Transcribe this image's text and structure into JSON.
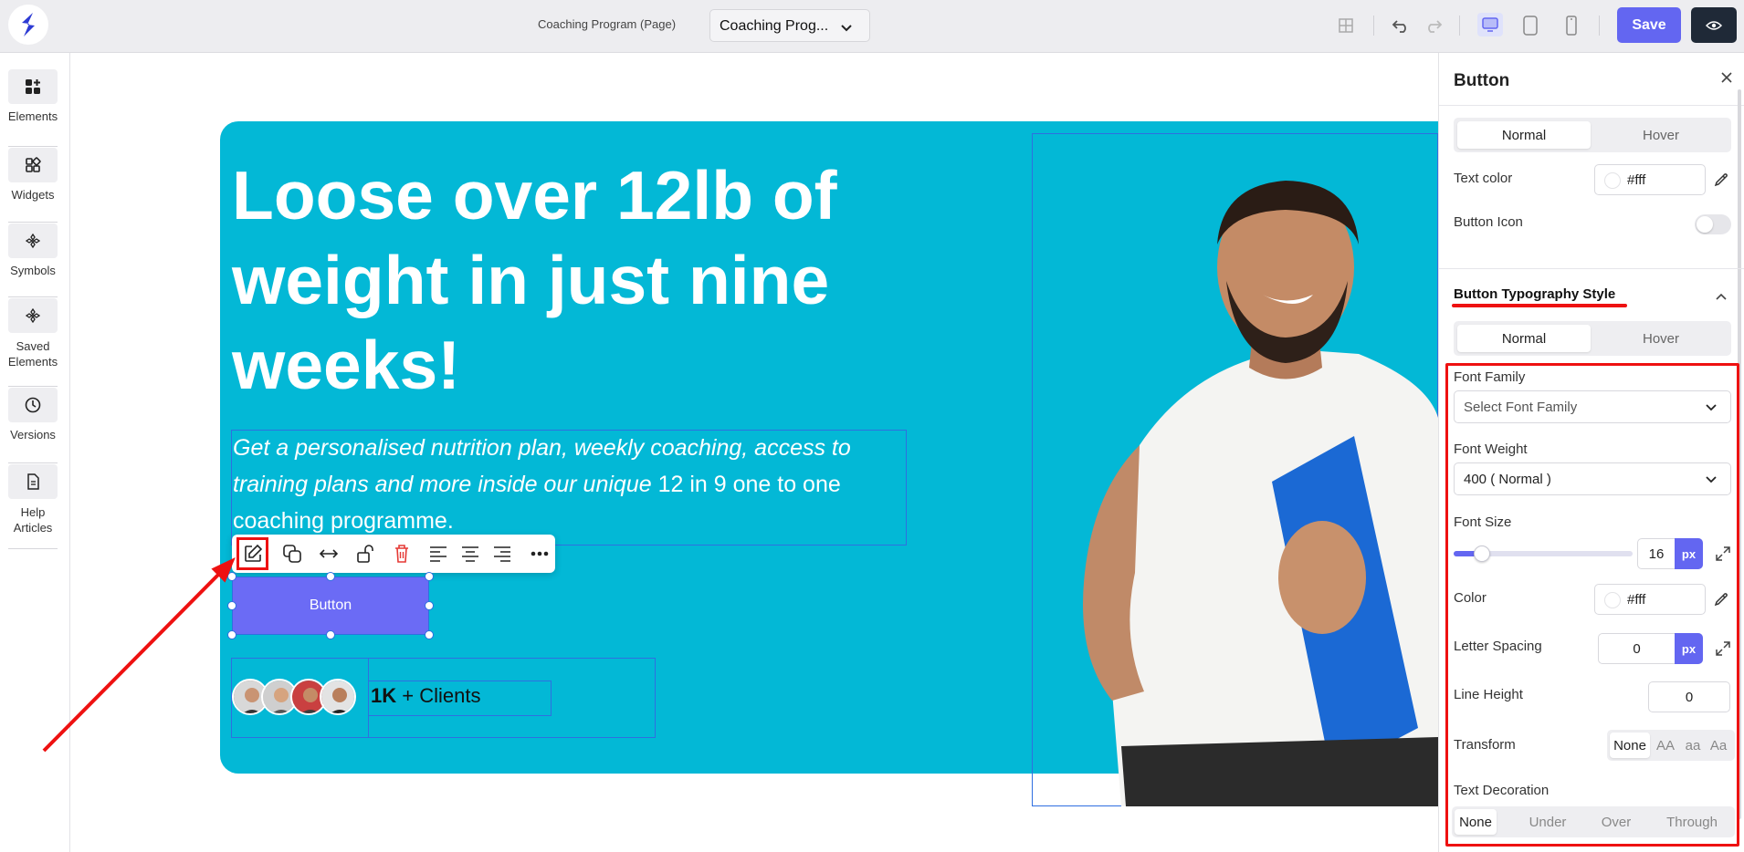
{
  "topbar": {
    "page_label": "Coaching Program (Page)",
    "page_select_value": "Coaching Prog...",
    "save_label": "Save"
  },
  "rail": {
    "items": [
      {
        "label": "Elements",
        "icon": "elements-icon"
      },
      {
        "label": "Widgets",
        "icon": "widgets-icon"
      },
      {
        "label": "Symbols",
        "icon": "symbols-icon"
      },
      {
        "label": "Saved Elements",
        "icon": "saved-elements-icon"
      },
      {
        "label": "Versions",
        "icon": "history-icon"
      },
      {
        "label": "Help Articles",
        "icon": "document-icon"
      }
    ]
  },
  "hero": {
    "title": "Loose over 12lb of weight in just nine weeks!",
    "subtitle_italic": "Get a personalised nutrition plan, weekly coaching, access to training plans and more inside our unique ",
    "subtitle_plain": "12 in 9 one to one coaching programme.",
    "button_label": "Button",
    "clients_bold": "1K",
    "clients_rest": " + Clients",
    "bg_color": "#03b8d6"
  },
  "panel": {
    "title": "Button",
    "state_tabs": [
      "Normal",
      "Hover"
    ],
    "text_color_label": "Text color",
    "text_color_value": "#fff",
    "button_icon_label": "Button Icon",
    "typography_title": "Button Typography Style",
    "typo_tabs": [
      "Normal",
      "Hover"
    ],
    "font_family_label": "Font Family",
    "font_family_placeholder": "Select Font Family",
    "font_weight_label": "Font Weight",
    "font_weight_value": "400 ( Normal )",
    "font_size_label": "Font Size",
    "font_size_value": "16",
    "font_size_unit": "px",
    "font_size_slider_fraction": 0.16,
    "color_label": "Color",
    "color_value": "#fff",
    "letter_spacing_label": "Letter Spacing",
    "letter_spacing_value": "0",
    "letter_spacing_unit": "px",
    "line_height_label": "Line Height",
    "line_height_value": "0",
    "transform_label": "Transform",
    "transform_options": [
      "None",
      "AA",
      "aa",
      "Aa"
    ],
    "text_decoration_label": "Text Decoration",
    "decoration_options": [
      "None",
      "Under",
      "Over",
      "Through"
    ]
  },
  "colors": {
    "accent": "#6366f1",
    "highlight": "#ee1111",
    "selection": "#2f6fe0"
  }
}
